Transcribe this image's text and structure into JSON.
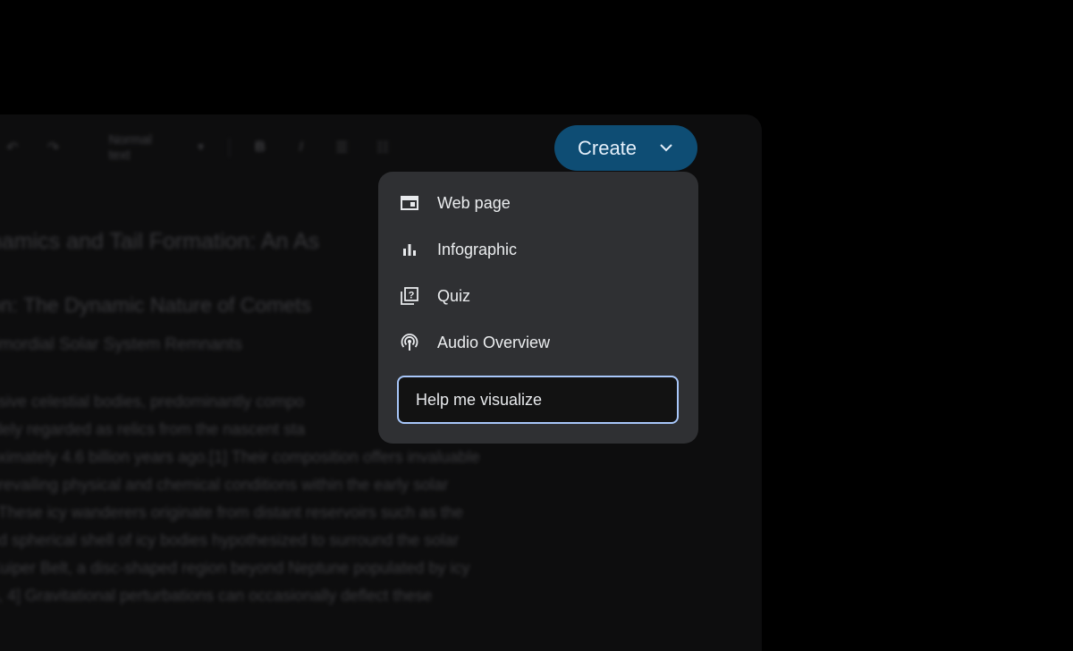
{
  "document": {
    "toolbar": {
      "undo_icon": "undo-icon",
      "redo_icon": "redo-icon",
      "style_label": "Normal text",
      "bold_icon": "bold-icon",
      "italic_icon": "italic-icon",
      "bullet_list_icon": "bulleted-list-icon",
      "numbered_list_icon": "numbered-list-icon"
    },
    "title": "namics and Tail Formation: An As",
    "heading": "on: The Dynamic Nature of Comets",
    "subheading": "rimordial Solar System Remnants",
    "paragraph_lines": [
      "nsive celestial bodies, predominantly compo",
      "idely regarded as relics from the nascent sta",
      "oximately 4.6 billion years ago.[1] Their composition offers invaluable",
      "prevailing physical and chemical conditions within the early solar",
      "] These icy wanderers originate from distant reservoirs such as the",
      "ed spherical shell of icy bodies hypothesized to surround the solar",
      "Kuiper Belt, a disc-shaped region beyond Neptune populated by icy",
      "3, 4] Gravitational perturbations can occasionally deflect these"
    ]
  },
  "create_button": {
    "label": "Create",
    "chevron_icon": "chevron-down-icon",
    "color": "#0e4d74"
  },
  "menu": {
    "items": [
      {
        "label": "Web page",
        "icon": "web-page-icon"
      },
      {
        "label": "Infographic",
        "icon": "bar-chart-icon"
      },
      {
        "label": "Quiz",
        "icon": "quiz-icon"
      },
      {
        "label": "Audio Overview",
        "icon": "podcast-icon"
      }
    ],
    "input": {
      "value": "Help me visualize",
      "border_color": "#a8c7fa"
    }
  }
}
